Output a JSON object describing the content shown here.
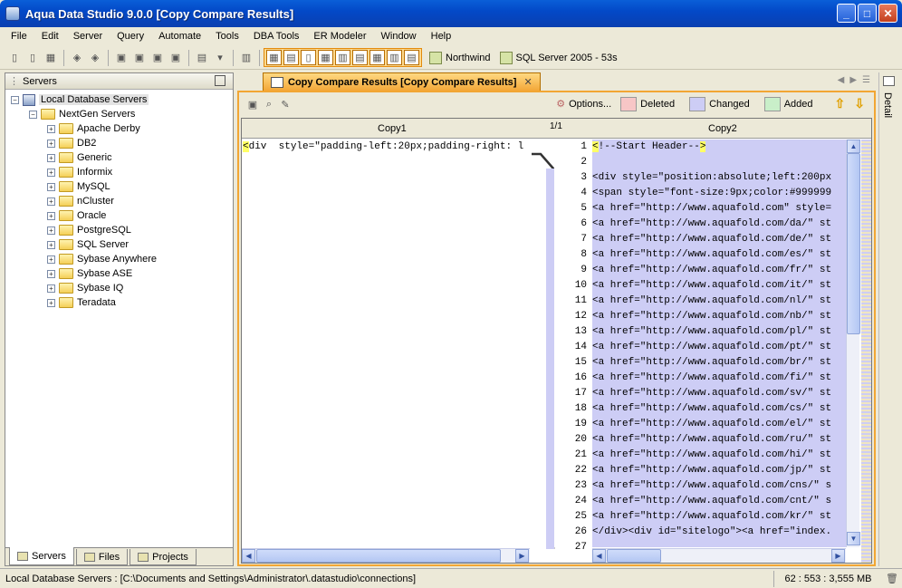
{
  "window": {
    "title": "Aqua Data Studio 9.0.0 [Copy Compare Results]"
  },
  "menu": [
    "File",
    "Edit",
    "Server",
    "Query",
    "Automate",
    "Tools",
    "DBA Tools",
    "ER Modeler",
    "Window",
    "Help"
  ],
  "toolbar": {
    "connection1": "Northwind",
    "connection2": "SQL Server 2005 - 53s"
  },
  "servers_panel": {
    "title": "Servers",
    "root": "Local Database Servers",
    "group": "NextGen Servers",
    "folders": [
      "Apache Derby",
      "DB2",
      "Generic",
      "Informix",
      "MySQL",
      "nCluster",
      "Oracle",
      "PostgreSQL",
      "SQL Server",
      "Sybase Anywhere",
      "Sybase ASE",
      "Sybase IQ",
      "Teradata"
    ],
    "tabs": [
      "Servers",
      "Files",
      "Projects"
    ]
  },
  "document": {
    "tab_title": "Copy Compare Results [Copy Compare Results]",
    "options_label": "Options...",
    "legend": [
      {
        "label": "Deleted",
        "color": "#f7c6c6"
      },
      {
        "label": "Changed",
        "color": "#cdcdf5"
      },
      {
        "label": "Added",
        "color": "#c9efc9"
      }
    ],
    "pane_left": "Copy1",
    "pane_right": "Copy2",
    "page_indicator": "1/1",
    "left_line": "<div  style=\"padding-left:20px;padding-right: l",
    "right_lines": [
      "<!--Start Header-->",
      "",
      "<div style=\"position:absolute;left:200px",
      "<span style=\"font-size:9px;color:#999999",
      "<a href=\"http://www.aquafold.com\" style=",
      "<a href=\"http://www.aquafold.com/da/\" st",
      "<a href=\"http://www.aquafold.com/de/\" st",
      "<a href=\"http://www.aquafold.com/es/\" st",
      "<a href=\"http://www.aquafold.com/fr/\" st",
      "<a href=\"http://www.aquafold.com/it/\" st",
      "<a href=\"http://www.aquafold.com/nl/\" st",
      "<a href=\"http://www.aquafold.com/nb/\" st",
      "<a href=\"http://www.aquafold.com/pl/\" st",
      "<a href=\"http://www.aquafold.com/pt/\" st",
      "<a href=\"http://www.aquafold.com/br/\" st",
      "<a href=\"http://www.aquafold.com/fi/\" st",
      "<a href=\"http://www.aquafold.com/sv/\" st",
      "<a href=\"http://www.aquafold.com/cs/\" st",
      "<a href=\"http://www.aquafold.com/el/\" st",
      "<a href=\"http://www.aquafold.com/ru/\" st",
      "<a href=\"http://www.aquafold.com/hi/\" st",
      "<a href=\"http://www.aquafold.com/jp/\" st",
      "<a href=\"http://www.aquafold.com/cns/\" s",
      "<a href=\"http://www.aquafold.com/cnt/\" s",
      "<a href=\"http://www.aquafold.com/kr/\" st",
      "</div><div id=\"sitelogo\"><a href=\"index.",
      ""
    ]
  },
  "detail_label": "Detail",
  "status": {
    "text": "Local Database Servers : [C:\\Documents and Settings\\Administrator\\.datastudio\\connections]",
    "memory": "62 : 553 : 3,555 MB"
  }
}
